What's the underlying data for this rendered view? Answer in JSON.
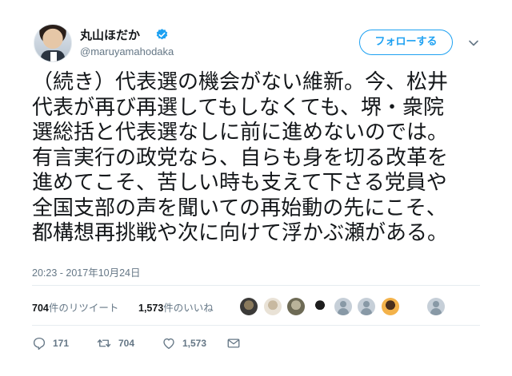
{
  "user": {
    "display_name": "丸山ほだか",
    "handle": "@maruyamahodaka",
    "verified": true
  },
  "follow_button_label": "フォローする",
  "tweet": {
    "lines": [
      "（続き）代表選の機会がない維新。今、松井",
      "代表が再び再選してもしなくても、堺・衆院",
      "選総括と代表選なしに前に進めないのでは。",
      "有言実行の政党なら、自らも身を切る改革を",
      "進めてこそ、苦しい時も支えて下さる党員や",
      "全国支部の声を聞いての再始動の先にこそ、",
      "都構想再挑戦や次に向けて浮かぶ瀬がある。"
    ],
    "timestamp": "20:23 - 2017年10月24日"
  },
  "stats": {
    "retweets_num": "704",
    "retweets_label": "件のリツイート",
    "likes_num": "1,573",
    "likes_label": "件のいいね"
  },
  "likers": [
    {
      "icon": "liker-avatar-1",
      "colors": [
        "#3b3a38",
        "#8a7a5c"
      ]
    },
    {
      "icon": "liker-avatar-2",
      "colors": [
        "#e9e2d6",
        "#c8b9a0"
      ]
    },
    {
      "icon": "liker-avatar-3",
      "colors": [
        "#6d6a55",
        "#b9b39a"
      ]
    },
    {
      "icon": "liker-avatar-4",
      "colors": [
        "#ffffff",
        "#1e1e1e"
      ]
    },
    {
      "icon": "default-avatar",
      "colors": []
    },
    {
      "icon": "default-avatar",
      "colors": []
    },
    {
      "icon": "liker-avatar-7",
      "colors": [
        "#f3b24a",
        "#4a2f1c"
      ]
    },
    {
      "icon": "default-avatar",
      "colors": []
    }
  ],
  "actions": {
    "reply_count": "171",
    "retweet_count": "704",
    "like_count": "1,573"
  },
  "colors": {
    "accent": "#1da1f2",
    "muted": "#657786",
    "text": "#14171a",
    "divider": "#e6ecf0"
  }
}
